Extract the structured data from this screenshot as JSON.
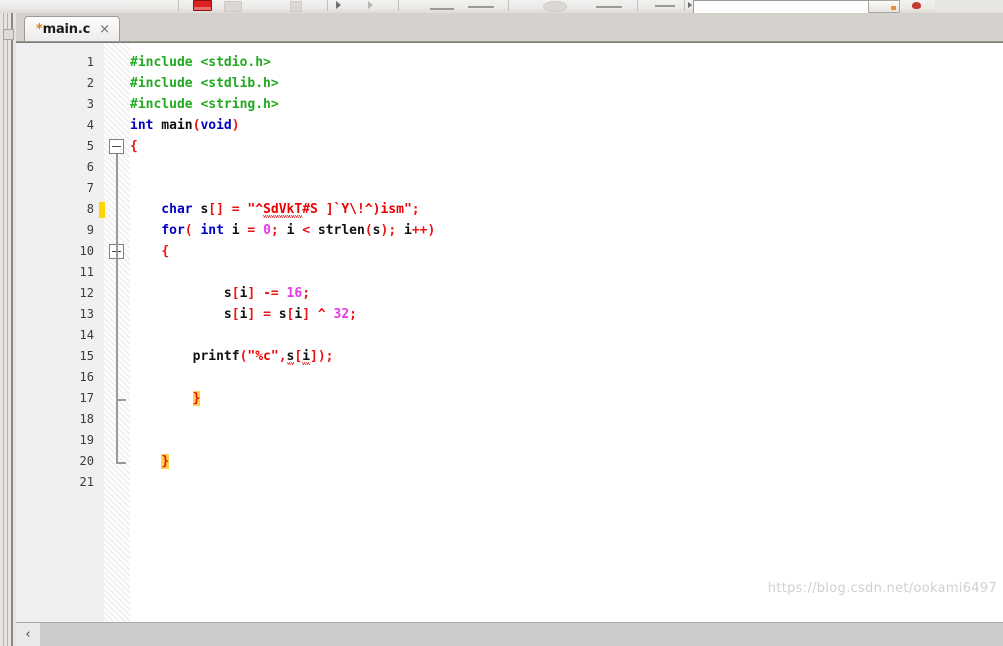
{
  "toolbar": {
    "stop_button_label": "stop-build",
    "search_field_value": "",
    "search_field_placeholder": "",
    "combo_label": ""
  },
  "tab": {
    "modified_marker": "*",
    "filename": "main.c",
    "close_label": "×"
  },
  "editor": {
    "line_numbers": [
      "1",
      "2",
      "3",
      "4",
      "5",
      "6",
      "7",
      "8",
      "9",
      "10",
      "11",
      "12",
      "13",
      "14",
      "15",
      "16",
      "17",
      "18",
      "19",
      "20",
      "21"
    ],
    "lines": [
      {
        "n": 1,
        "tokens": [
          {
            "t": "#include <stdio.h>",
            "c": "k-pre"
          }
        ]
      },
      {
        "n": 2,
        "tokens": [
          {
            "t": "#include <stdlib.h>",
            "c": "k-pre"
          }
        ]
      },
      {
        "n": 3,
        "tokens": [
          {
            "t": "#include <string.h>",
            "c": "k-pre"
          }
        ]
      },
      {
        "n": 4,
        "tokens": [
          {
            "t": "int",
            "c": "k-kw"
          },
          {
            "t": " main",
            "c": "k-id"
          },
          {
            "t": "(",
            "c": "k-op"
          },
          {
            "t": "void",
            "c": "k-kw"
          },
          {
            "t": ")",
            "c": "k-op"
          }
        ]
      },
      {
        "n": 5,
        "tokens": [
          {
            "t": "{",
            "c": "k-brace"
          }
        ]
      },
      {
        "n": 6,
        "tokens": []
      },
      {
        "n": 7,
        "tokens": []
      },
      {
        "n": 8,
        "tokens": [
          {
            "t": "    char",
            "c": "k-kw"
          },
          {
            "t": " s",
            "c": "k-id"
          },
          {
            "t": "[] ",
            "c": "k-op"
          },
          {
            "t": "= ",
            "c": "k-op"
          },
          {
            "t": "\"^",
            "c": "k-str"
          },
          {
            "t": "SdVkT",
            "c": "k-str squiggle"
          },
          {
            "t": "#S ]`Y\\!^)ism\"",
            "c": "k-str"
          },
          {
            "t": ";",
            "c": "k-op"
          }
        ]
      },
      {
        "n": 9,
        "tokens": [
          {
            "t": "    for",
            "c": "k-kw"
          },
          {
            "t": "( ",
            "c": "k-op"
          },
          {
            "t": "int",
            "c": "k-kw"
          },
          {
            "t": " i ",
            "c": "k-id"
          },
          {
            "t": "= ",
            "c": "k-op"
          },
          {
            "t": "0",
            "c": "k-num"
          },
          {
            "t": "; ",
            "c": "k-op"
          },
          {
            "t": "i ",
            "c": "k-id"
          },
          {
            "t": "< ",
            "c": "k-op"
          },
          {
            "t": "strlen",
            "c": "k-id"
          },
          {
            "t": "(",
            "c": "k-op"
          },
          {
            "t": "s",
            "c": "k-id"
          },
          {
            "t": "); ",
            "c": "k-op"
          },
          {
            "t": "i",
            "c": "k-id"
          },
          {
            "t": "++)",
            "c": "k-op"
          }
        ]
      },
      {
        "n": 10,
        "tokens": [
          {
            "t": "    ",
            "c": "k-id"
          },
          {
            "t": "{",
            "c": "k-brace"
          }
        ]
      },
      {
        "n": 11,
        "tokens": []
      },
      {
        "n": 12,
        "tokens": [
          {
            "t": "            s",
            "c": "k-id"
          },
          {
            "t": "[",
            "c": "k-op"
          },
          {
            "t": "i",
            "c": "k-id"
          },
          {
            "t": "] ",
            "c": "k-op"
          },
          {
            "t": "-= ",
            "c": "k-op"
          },
          {
            "t": "16",
            "c": "k-num"
          },
          {
            "t": ";",
            "c": "k-op"
          }
        ]
      },
      {
        "n": 13,
        "tokens": [
          {
            "t": "            s",
            "c": "k-id"
          },
          {
            "t": "[",
            "c": "k-op"
          },
          {
            "t": "i",
            "c": "k-id"
          },
          {
            "t": "] ",
            "c": "k-op"
          },
          {
            "t": "= ",
            "c": "k-op"
          },
          {
            "t": "s",
            "c": "k-id"
          },
          {
            "t": "[",
            "c": "k-op"
          },
          {
            "t": "i",
            "c": "k-id"
          },
          {
            "t": "] ",
            "c": "k-op"
          },
          {
            "t": "^ ",
            "c": "k-op"
          },
          {
            "t": "32",
            "c": "k-num"
          },
          {
            "t": ";",
            "c": "k-op"
          }
        ]
      },
      {
        "n": 14,
        "tokens": []
      },
      {
        "n": 15,
        "tokens": [
          {
            "t": "        printf",
            "c": "k-id"
          },
          {
            "t": "(",
            "c": "k-op"
          },
          {
            "t": "\"%c\"",
            "c": "k-str"
          },
          {
            "t": ",",
            "c": "k-op"
          },
          {
            "t": "s",
            "c": "k-id squiggle"
          },
          {
            "t": "[",
            "c": "k-op"
          },
          {
            "t": "i",
            "c": "k-id squiggle"
          },
          {
            "t": "]",
            "c": "k-op"
          },
          {
            "t": ");",
            "c": "k-op"
          }
        ]
      },
      {
        "n": 16,
        "tokens": []
      },
      {
        "n": 17,
        "tokens": [
          {
            "t": "        ",
            "c": "k-id"
          },
          {
            "t": "}",
            "c": "k-brace-hl"
          }
        ]
      },
      {
        "n": 18,
        "tokens": []
      },
      {
        "n": 19,
        "tokens": []
      },
      {
        "n": 20,
        "tokens": [
          {
            "t": "    ",
            "c": "k-id"
          },
          {
            "t": "}",
            "c": "k-brace-hl"
          }
        ]
      },
      {
        "n": 21,
        "tokens": []
      }
    ],
    "fold_markers": [
      {
        "line": 5,
        "type": "collapse-box"
      },
      {
        "line": 10,
        "type": "collapse-box"
      }
    ],
    "change_marker_line": 8
  },
  "scrollbar": {
    "left_arrow": "‹"
  },
  "watermark": {
    "text": "https://blog.csdn.net/ookami6497"
  },
  "colors": {
    "preprocessor": "#1faa1f",
    "keyword": "#0000c8",
    "string": "#ee0000",
    "number": "#e839e8",
    "operator": "#ee1111",
    "brace_highlight": "#ffd24a",
    "change_marker": "#ffd700",
    "tab_modified": "#e07b1a"
  }
}
